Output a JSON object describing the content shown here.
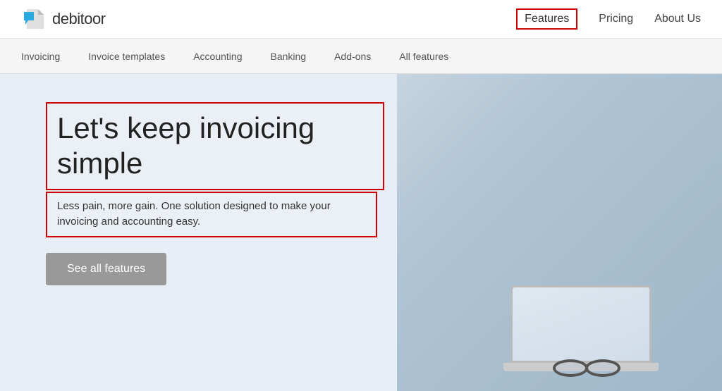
{
  "brand": {
    "name": "debitoor"
  },
  "topNav": {
    "links": [
      {
        "id": "features",
        "label": "Features",
        "active": true
      },
      {
        "id": "pricing",
        "label": "Pricing",
        "active": false
      },
      {
        "id": "about",
        "label": "About Us",
        "active": false
      }
    ]
  },
  "subNav": {
    "links": [
      {
        "id": "invoicing",
        "label": "Invoicing"
      },
      {
        "id": "invoice-templates",
        "label": "Invoice templates"
      },
      {
        "id": "accounting",
        "label": "Accounting"
      },
      {
        "id": "banking",
        "label": "Banking"
      },
      {
        "id": "add-ons",
        "label": "Add-ons"
      },
      {
        "id": "all-features",
        "label": "All features"
      }
    ]
  },
  "hero": {
    "headline": "Let's keep invoicing simple",
    "subtext": "Less pain, more gain. One solution designed to make your invoicing and accounting easy.",
    "cta_label": "See all features"
  }
}
